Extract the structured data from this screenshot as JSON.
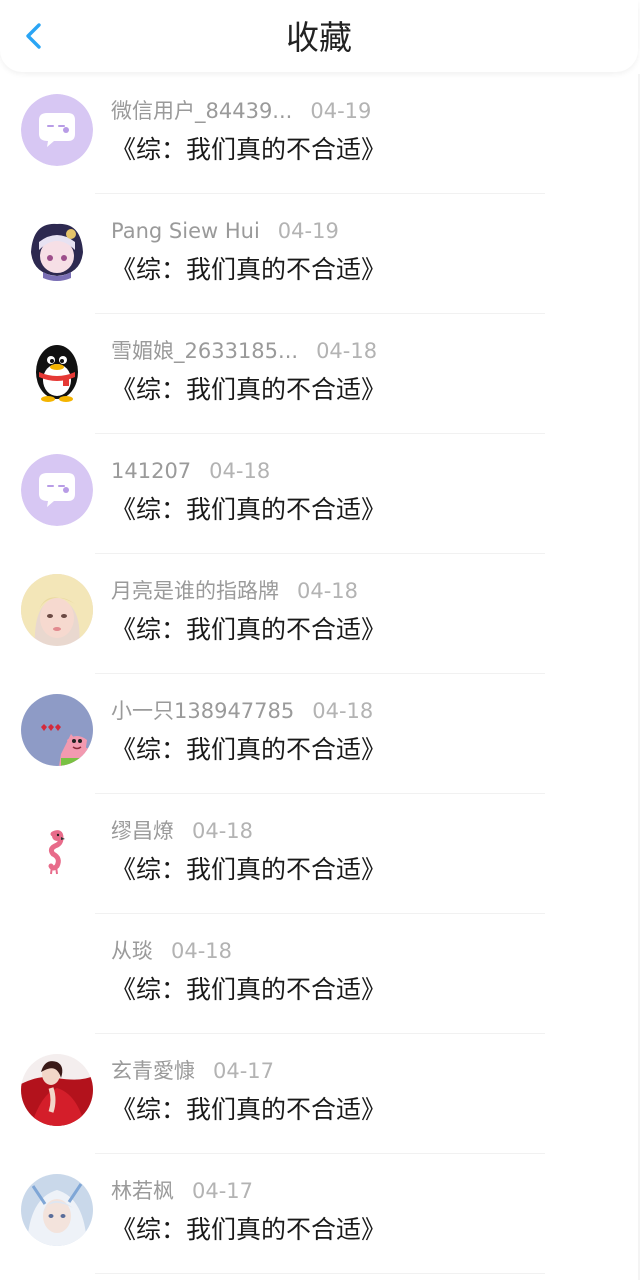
{
  "header": {
    "title": "收藏",
    "back_icon": "chevron-left-icon",
    "accent_color": "#2aa5f5"
  },
  "favorites": [
    {
      "username": "微信用户_84439...",
      "date": "04-19",
      "book": "《综：我们真的不合适》",
      "avatar": "wechat-default-avatar"
    },
    {
      "username": "Pang Siew Hui",
      "date": "04-19",
      "book": "《综：我们真的不合适》",
      "avatar": "anime-girl-avatar"
    },
    {
      "username": "雪媚娘_2633185...",
      "date": "04-18",
      "book": "《综：我们真的不合适》",
      "avatar": "qq-penguin-avatar"
    },
    {
      "username": "141207",
      "date": "04-18",
      "book": "《综：我们真的不合适》",
      "avatar": "wechat-default-avatar"
    },
    {
      "username": "月亮是谁的指路牌",
      "date": "04-18",
      "book": "《综：我们真的不合适》",
      "avatar": "photo-girl-avatar"
    },
    {
      "username": "小一只138947785",
      "date": "04-18",
      "book": "《综：我们真的不合适》",
      "avatar": "patrick-star-avatar"
    },
    {
      "username": "缪昌燎",
      "date": "04-18",
      "book": "《综：我们真的不合适》",
      "avatar": "pink-flamingo-avatar"
    },
    {
      "username": "从琰",
      "date": "04-18",
      "book": "《综：我们真的不合适》",
      "avatar": "blank-avatar"
    },
    {
      "username": "玄青愛慷",
      "date": "04-17",
      "book": "《综：我们真的不合适》",
      "avatar": "red-dress-avatar"
    },
    {
      "username": "林若枫",
      "date": "04-17",
      "book": "《综：我们真的不合适》",
      "avatar": "white-hair-avatar"
    }
  ]
}
